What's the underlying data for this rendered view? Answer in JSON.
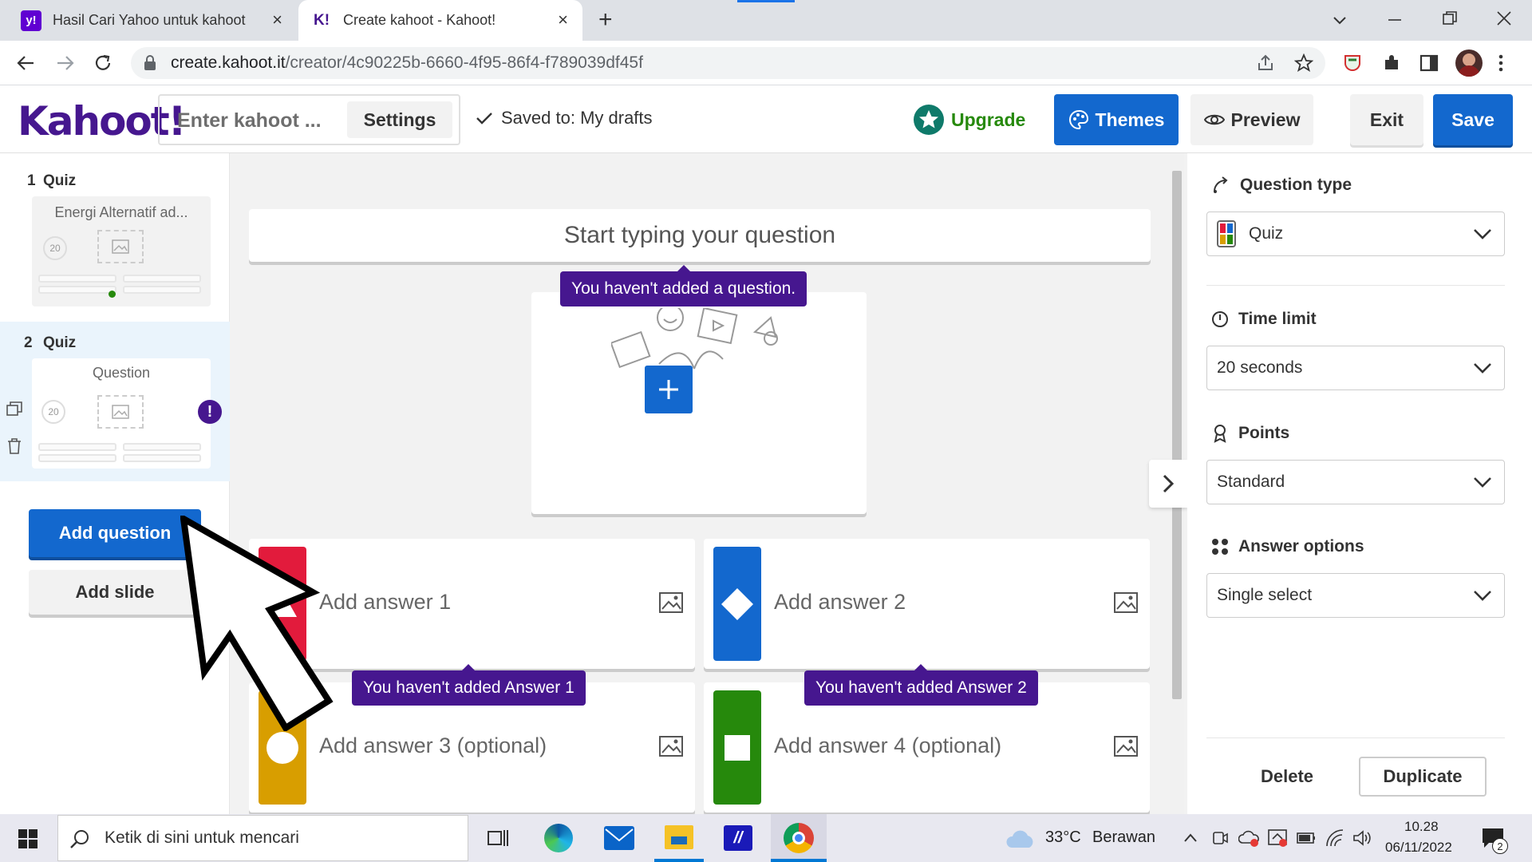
{
  "browser": {
    "tabs": [
      {
        "title": "Hasil Cari Yahoo untuk kahoot",
        "favicon_text": "y!",
        "favicon_color": "#6001d2"
      },
      {
        "title": "Create kahoot - Kahoot!",
        "favicon_text": "K!",
        "favicon_color": "#46178f"
      }
    ],
    "new_tab": "+",
    "url_host": "create.kahoot.it",
    "url_path": "/creator/4c90225b-6660-4f95-86f4-f789039df45f"
  },
  "header": {
    "logo": "Kahoot!",
    "title_placeholder": "Enter kahoot ...",
    "settings": "Settings",
    "saved": "Saved to: My drafts",
    "upgrade": "Upgrade",
    "themes": "Themes",
    "preview": "Preview",
    "exit": "Exit",
    "save": "Save"
  },
  "sidebar": {
    "slides": [
      {
        "number": "1",
        "type": "Quiz",
        "title": "Energi Alternatif ad...",
        "time": "20"
      },
      {
        "number": "2",
        "type": "Quiz",
        "title": "Question",
        "time": "20"
      }
    ],
    "add_question": "Add question",
    "add_slide": "Add slide"
  },
  "editor": {
    "question_placeholder": "Start typing your question",
    "question_warning": "You haven't added a question.",
    "answers": [
      {
        "placeholder": "Add answer 1",
        "color": "#e21b3c",
        "shape": "triangle"
      },
      {
        "placeholder": "Add answer 2",
        "color": "#1368ce",
        "shape": "diamond"
      },
      {
        "placeholder": "Add answer 3 (optional)",
        "color": "#d89e00",
        "shape": "circle"
      },
      {
        "placeholder": "Add answer 4 (optional)",
        "color": "#26890c",
        "shape": "square"
      }
    ],
    "answer1_warning": "You haven't added Answer 1",
    "answer2_warning": "You haven't added Answer 2"
  },
  "panel": {
    "question_type_label": "Question type",
    "question_type_value": "Quiz",
    "time_limit_label": "Time limit",
    "time_limit_value": "20 seconds",
    "points_label": "Points",
    "points_value": "Standard",
    "answer_options_label": "Answer options",
    "answer_options_value": "Single select",
    "delete": "Delete",
    "duplicate": "Duplicate"
  },
  "taskbar": {
    "search_placeholder": "Ketik di sini untuk mencari",
    "weather_temp": "33°C",
    "weather_text": "Berawan",
    "time": "10.28",
    "date": "06/11/2022",
    "notification_count": "2"
  },
  "colors": {
    "kahoot_purple": "#46178f",
    "primary_blue": "#1368ce",
    "upgrade_green": "#26890c"
  }
}
